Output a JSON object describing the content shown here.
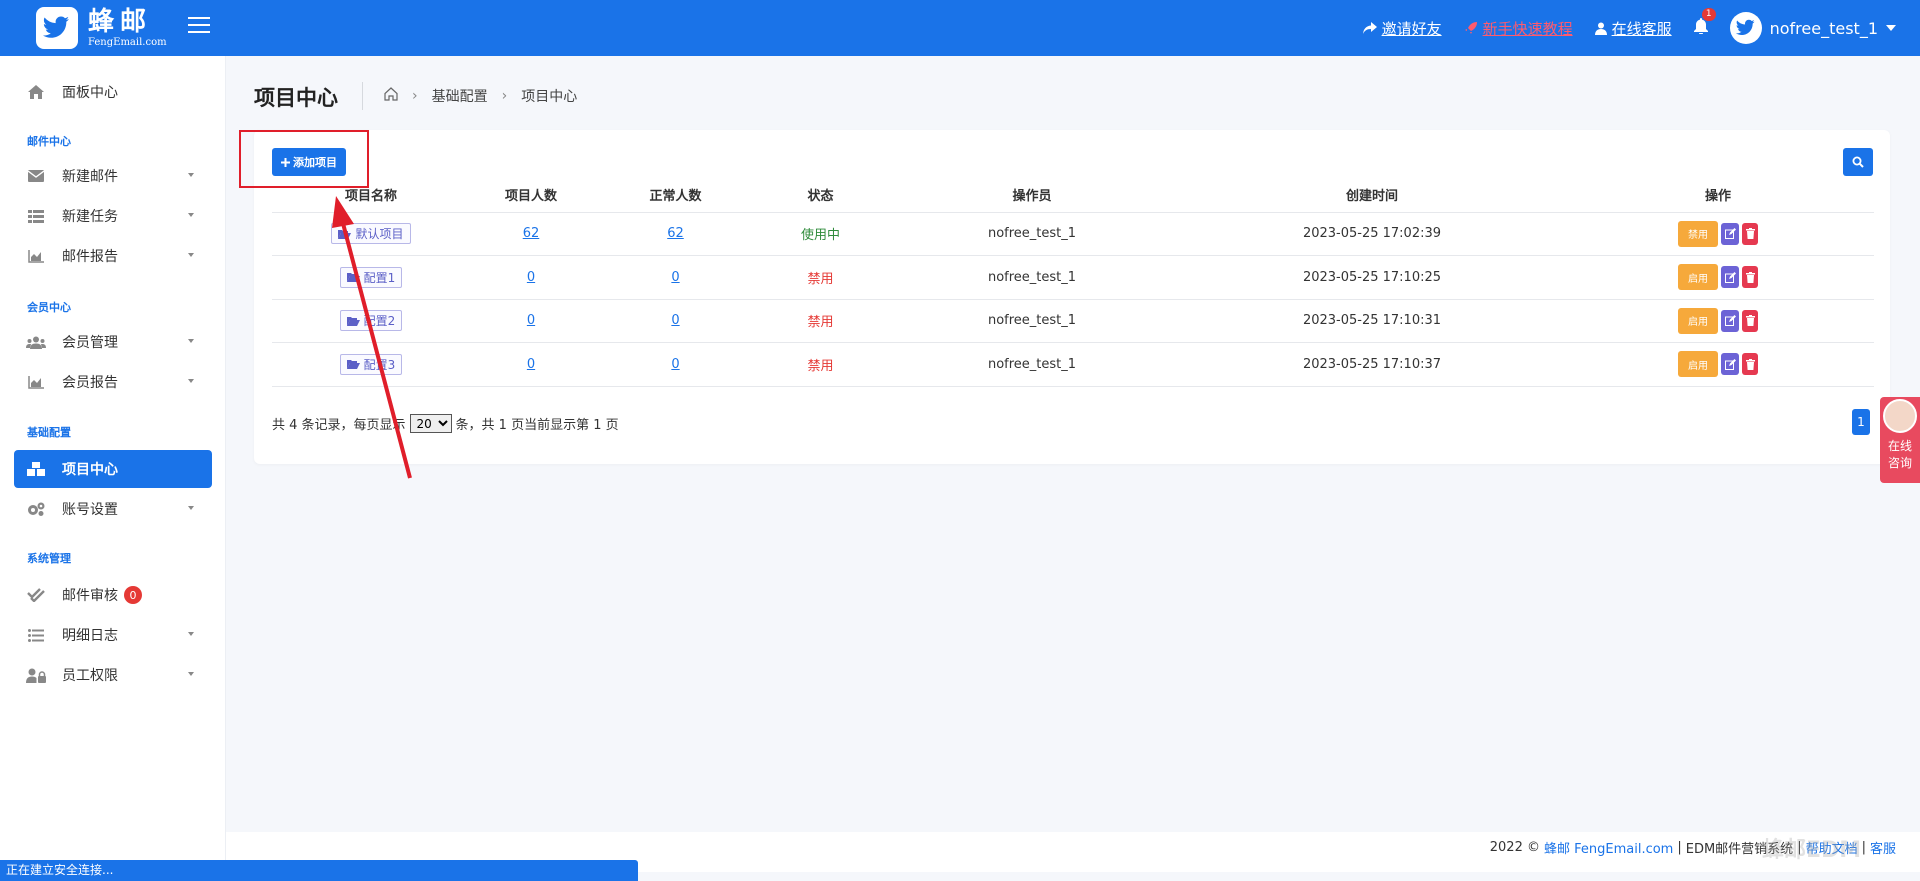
{
  "brand": {
    "name": "蜂邮",
    "sub": "FengEmail.com"
  },
  "header": {
    "invite": "邀请好友",
    "tutorial": "新手快速教程",
    "service": "在线客服",
    "bell_count": "1",
    "username": "nofree_test_1"
  },
  "sidebar": {
    "dashboard": "面板中心",
    "sec_mail": "邮件中心",
    "new_mail": "新建邮件",
    "new_task": "新建任务",
    "mail_report": "邮件报告",
    "sec_member": "会员中心",
    "member_manage": "会员管理",
    "member_report": "会员报告",
    "sec_basic": "基础配置",
    "project_center": "项目中心",
    "account_settings": "账号设置",
    "sec_system": "系统管理",
    "mail_audit": "邮件审核",
    "audit_count": "0",
    "detail_log": "明细日志",
    "staff_perm": "员工权限"
  },
  "page": {
    "title": "项目中心",
    "breadcrumb": [
      "基础配置",
      "项目中心"
    ]
  },
  "toolbar": {
    "add_label": "添加项目"
  },
  "table": {
    "headers": [
      "项目名称",
      "项目人数",
      "正常人数",
      "状态",
      "操作员",
      "创建时间",
      "操作"
    ],
    "rows": [
      {
        "name": "默认项目",
        "count": "62",
        "normal": "62",
        "status": "使用中",
        "operator": "nofree_test_1",
        "created": "2023-05-25 17:02:39",
        "toggle": "禁用"
      },
      {
        "name": "配置1",
        "count": "0",
        "normal": "0",
        "status": "禁用",
        "operator": "nofree_test_1",
        "created": "2023-05-25 17:10:25",
        "toggle": "启用"
      },
      {
        "name": "配置2",
        "count": "0",
        "normal": "0",
        "status": "禁用",
        "operator": "nofree_test_1",
        "created": "2023-05-25 17:10:31",
        "toggle": "启用"
      },
      {
        "name": "配置3",
        "count": "0",
        "normal": "0",
        "status": "禁用",
        "operator": "nofree_test_1",
        "created": "2023-05-25 17:10:37",
        "toggle": "启用"
      }
    ]
  },
  "pager": {
    "prefix": "共 4 条记录，每页显示",
    "page_size": "20",
    "suffix": "条，共 1 页当前显示第 1 页",
    "current": "1"
  },
  "consult": {
    "line1": "在线",
    "line2": "咨询"
  },
  "footer": {
    "year": "2022 ©",
    "brand_link": "蜂邮 FengEmail.com",
    "sep1": "|",
    "product": "EDM邮件营销系统",
    "sep2": "|",
    "help": "帮助文档",
    "sep3": "|",
    "service": "客服"
  },
  "watermark": "蜂邮EDM",
  "status_bar": "正在建立安全连接..."
}
